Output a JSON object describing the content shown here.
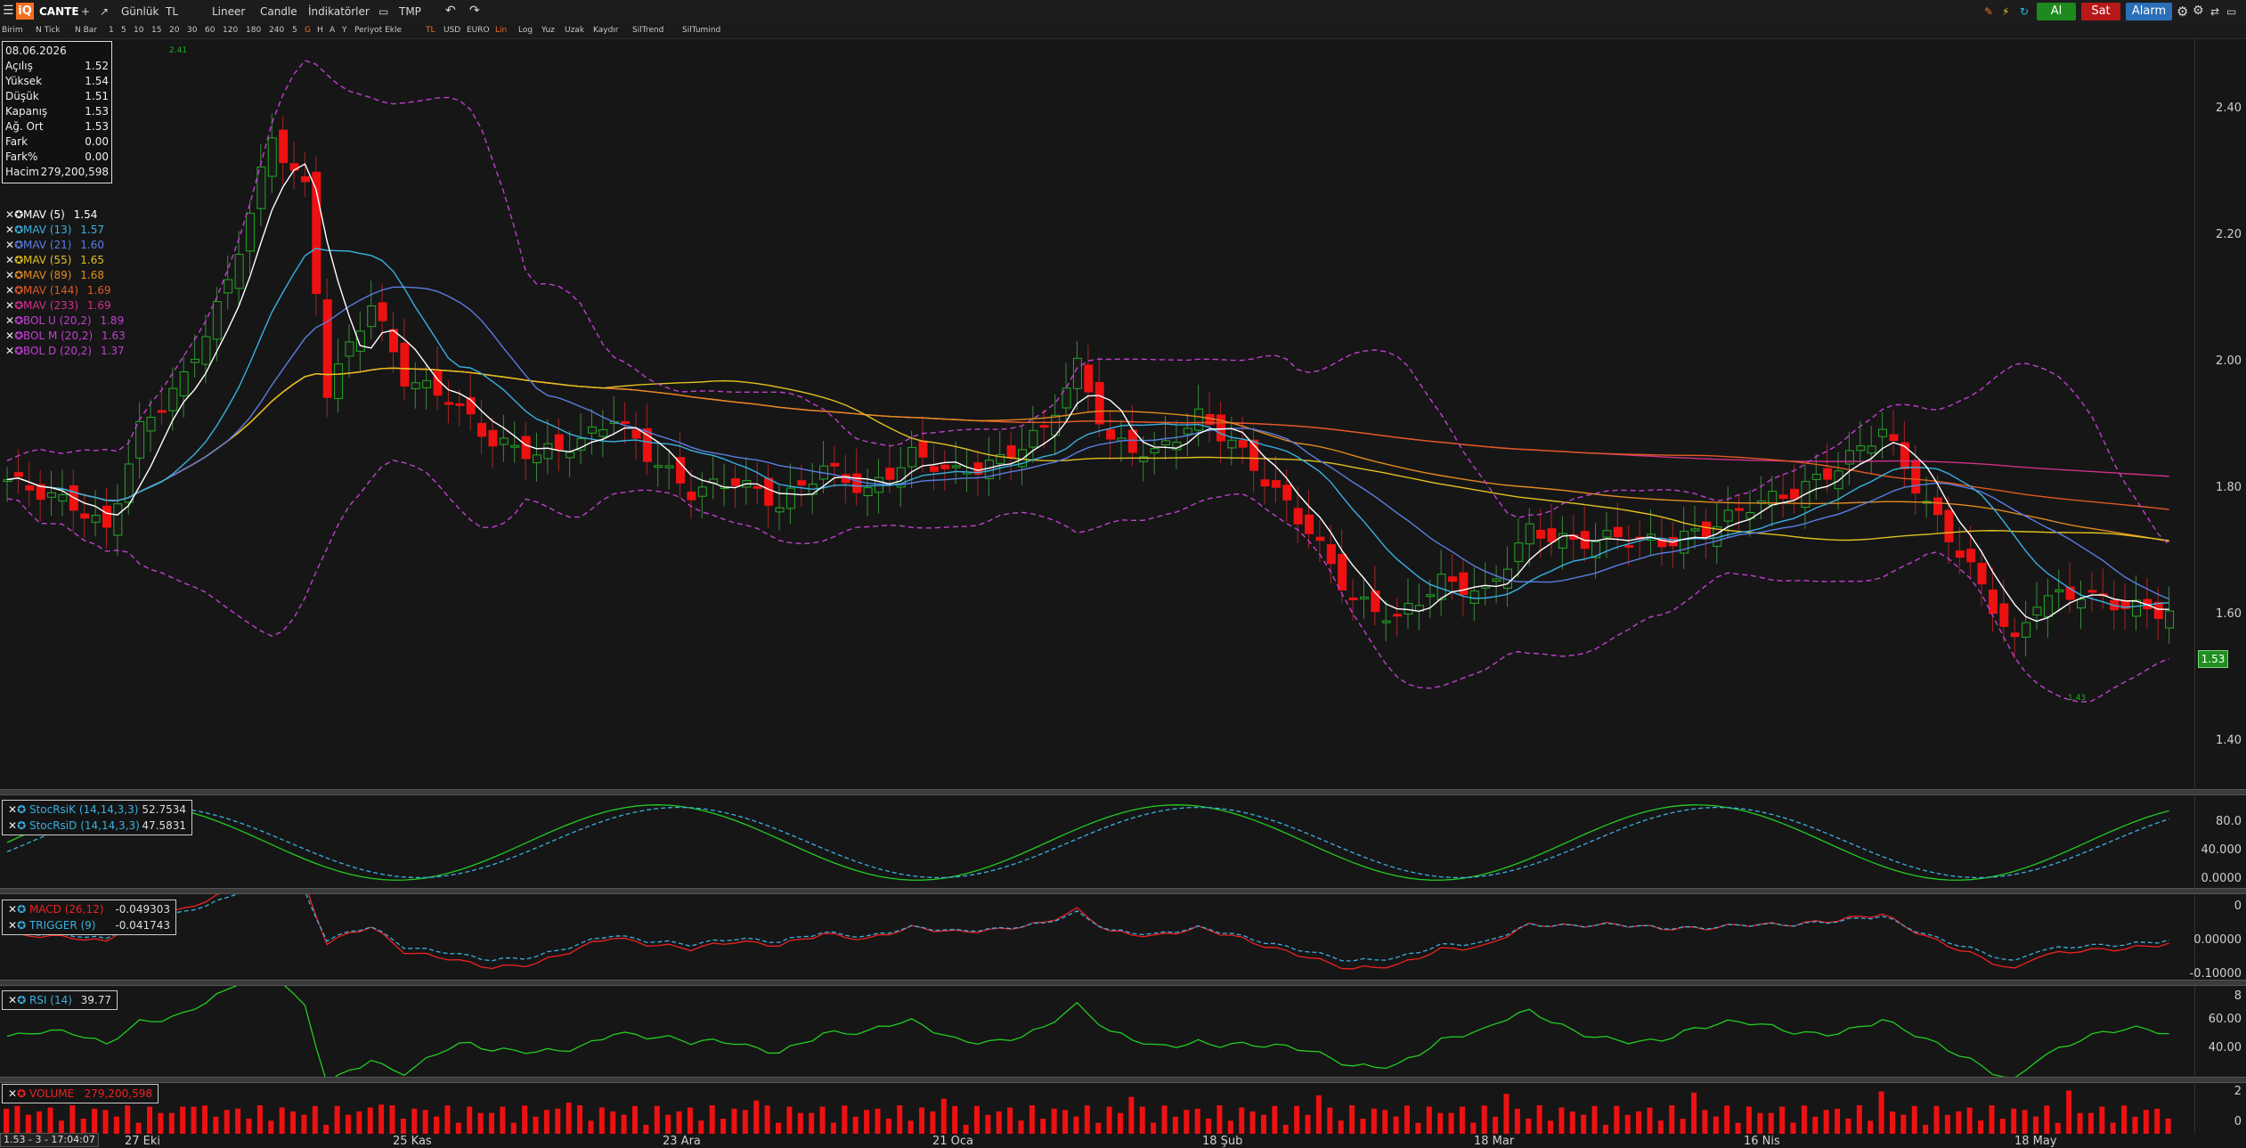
{
  "toolbar": {
    "symbol": "CANTE",
    "plus": "+",
    "period": "Günlük",
    "currency": "TL",
    "scale": "Lineer",
    "chart_type": "Candle",
    "indicators": "İndikatörler",
    "template": "TMP",
    "buy_label": "Al",
    "sell_label": "Sat",
    "alarm_label": "Alarm"
  },
  "toolbar2": {
    "items": [
      "Birim",
      "N Tick",
      "N Bar",
      "1",
      "5",
      "10",
      "15",
      "20",
      "30",
      "60",
      "120",
      "180",
      "240",
      "5",
      "G",
      "H",
      "A",
      "Y",
      "Periyot Ekle",
      "TL",
      "USD",
      "EURO",
      "Lin",
      "Log",
      "Yuz",
      "Uzak",
      "Kaydır",
      "SilTrend",
      "SilTumind"
    ]
  },
  "ohlc": {
    "date": "08.06.2026",
    "rows": [
      {
        "k": "Açılış",
        "v": "1.52"
      },
      {
        "k": "Yüksek",
        "v": "1.54"
      },
      {
        "k": "Düşük",
        "v": "1.51"
      },
      {
        "k": "Kapanış",
        "v": "1.53"
      },
      {
        "k": "Ağ. Ort",
        "v": "1.53"
      },
      {
        "k": "Fark",
        "v": "0.00"
      },
      {
        "k": "Fark%",
        "v": "0.00"
      },
      {
        "k": "Hacim",
        "v": "279,200,598"
      }
    ]
  },
  "legend": [
    {
      "name": "MAV (5)",
      "value": "1.54",
      "color": "#ffffff"
    },
    {
      "name": "MAV (13)",
      "value": "1.57",
      "color": "#3ab0e0"
    },
    {
      "name": "MAV (21)",
      "value": "1.60",
      "color": "#5a7de0"
    },
    {
      "name": "MAV (55)",
      "value": "1.65",
      "color": "#e0c020"
    },
    {
      "name": "MAV (89)",
      "value": "1.68",
      "color": "#e08a20"
    },
    {
      "name": "MAV (144)",
      "value": "1.69",
      "color": "#e05a20"
    },
    {
      "name": "MAV (233)",
      "value": "1.69",
      "color": "#d0308a"
    },
    {
      "name": "BOL U (20,2)",
      "value": "1.89",
      "color": "#c040d0"
    },
    {
      "name": "BOL M (20,2)",
      "value": "1.63",
      "color": "#c040d0"
    },
    {
      "name": "BOL D (20,2)",
      "value": "1.37",
      "color": "#c040d0"
    }
  ],
  "price_axis": [
    "2.40",
    "2.20",
    "2.00",
    "1.80",
    "1.60",
    "1.40"
  ],
  "last_price": "1.53",
  "high_marker": "2.41",
  "low_marker": "1.43",
  "stoch": {
    "k_label": "StocRsiK (14,14,3,3)",
    "k_value": "52.7534",
    "d_label": "StocRsiD (14,14,3,3)",
    "d_value": "47.5831",
    "axis": [
      "80.0",
      "40.000",
      "0.0000"
    ]
  },
  "macd": {
    "label": "MACD (26,12)",
    "value": "-0.049303",
    "trig_label": "TRIGGER (9)",
    "trig_value": "-0.041743",
    "axis": [
      "0",
      "0.00000",
      "-0.10000"
    ]
  },
  "rsi": {
    "label": "RSI (14)",
    "value": "39.77",
    "axis": [
      "8",
      "60.00",
      "40.00"
    ]
  },
  "volume": {
    "label": "VOLUME",
    "value": "279,200,598",
    "axis": [
      "2",
      "0"
    ]
  },
  "date_axis": [
    "27 Eki",
    "25 Kas",
    "23 Ara",
    "21 Oca",
    "18 Şub",
    "18 Mar",
    "16 Nis",
    "18 May"
  ],
  "status": "1.53 - 3 - 17:04:07",
  "colors": {
    "up": "#22aa22",
    "down": "#ee1111",
    "bg": "#161616"
  }
}
